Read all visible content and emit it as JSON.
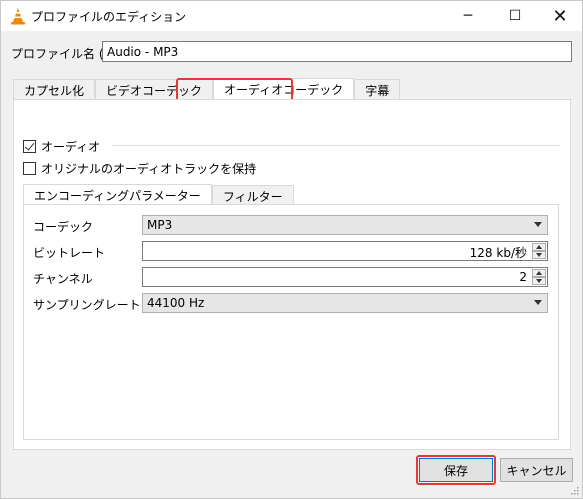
{
  "window": {
    "title": "プロファイルのエディション",
    "minimize_glyph": "─",
    "maximize_glyph": "☐",
    "close_glyph": "✕",
    "app_icon": "vlc-cone-icon"
  },
  "profile": {
    "label": "プロファイル名 (N)",
    "value": "Audio - MP3"
  },
  "tabs": [
    {
      "label": "カプセル化"
    },
    {
      "label": "ビデオコーデック"
    },
    {
      "label": "オーディオコーデック"
    },
    {
      "label": "字幕"
    }
  ],
  "active_tab_index": 2,
  "audio": {
    "group_label": "オーディオ",
    "audio_checked": true,
    "keep_original_label": "オリジナルのオーディオトラックを保持",
    "keep_original_checked": false,
    "subtabs": [
      {
        "label": "エンコーディングパラメーター"
      },
      {
        "label": "フィルター"
      }
    ],
    "fields": {
      "codec_label": "コーデック",
      "codec_value": "MP3",
      "bitrate_label": "ビットレート",
      "bitrate_value": "128 kb/秒",
      "channels_label": "チャンネル",
      "channels_value": "2",
      "samplerate_label": "サンプリングレート (m)",
      "samplerate_value": "44100 Hz"
    }
  },
  "buttons": {
    "save": "保存",
    "cancel": "キャンセル"
  },
  "colors": {
    "highlight": "#e53935",
    "focus_border": "#0078d7"
  }
}
